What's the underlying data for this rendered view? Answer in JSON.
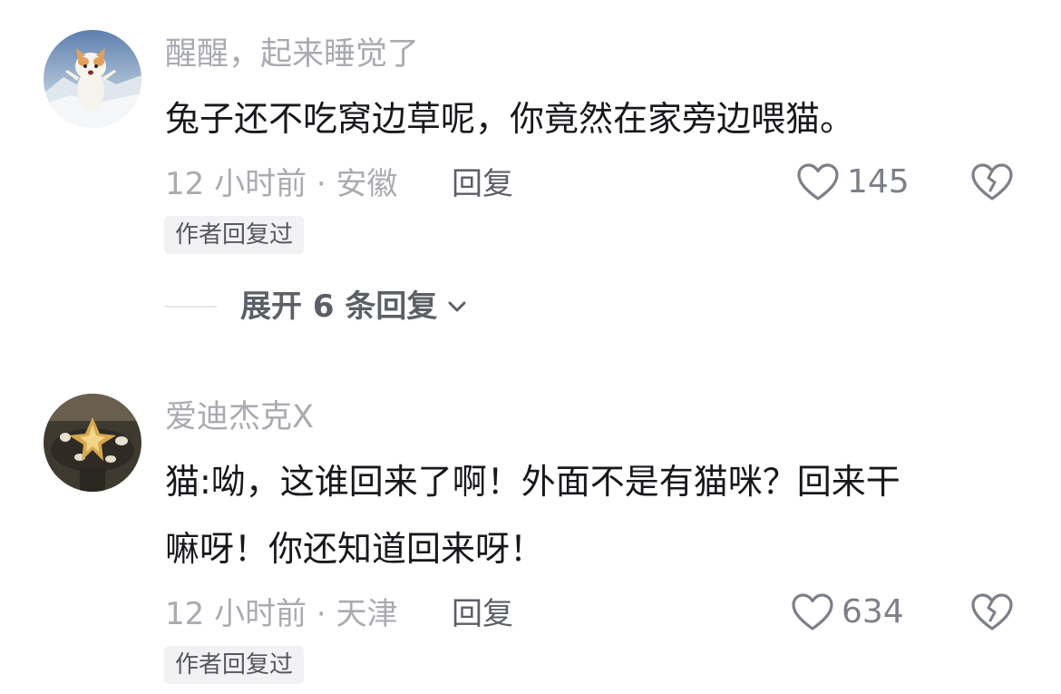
{
  "comments": [
    {
      "username": "醒醒，起来睡觉了",
      "text": "兔子还不吃窝边草呢，你竟然在家旁边喂猫。",
      "meta": "12 小时前 · 安徽",
      "reply_label": "回复",
      "likes": "145",
      "badge": "作者回复过",
      "expand_replies": "展开 6 条回复"
    },
    {
      "username": "爱迪杰克X",
      "text": "猫:呦，这谁回来了啊！外面不是有猫咪？回来干\n嘛呀！你还知道回来呀！",
      "meta": "12 小时前 · 天津",
      "reply_label": "回复",
      "likes": "634",
      "badge": "作者回复过"
    }
  ],
  "icons": {
    "like": "heart-outline-icon",
    "dislike": "broken-heart-icon",
    "expand": "chevron-down-icon"
  },
  "colors": {
    "primary_text": "#17181c",
    "secondary_text": "#a9abb1",
    "badge_bg": "#f2f2f4"
  }
}
